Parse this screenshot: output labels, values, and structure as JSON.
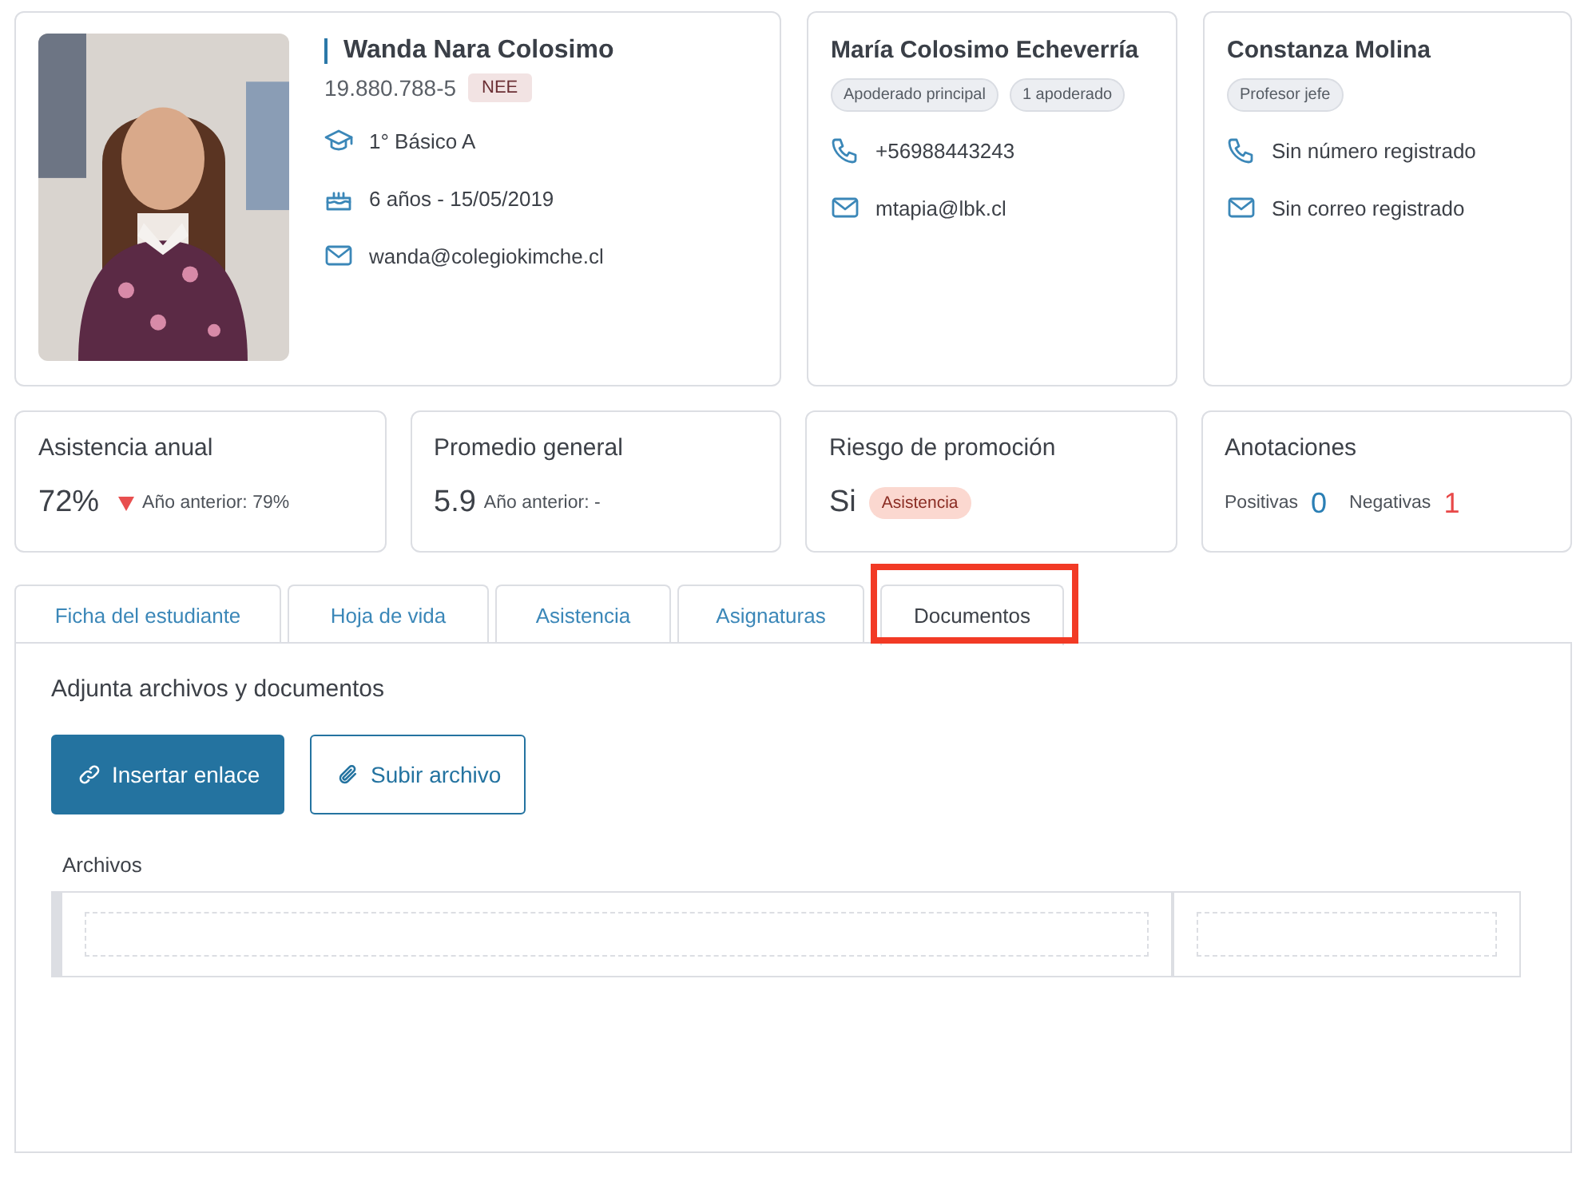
{
  "student": {
    "name": "Wanda Nara Colosimo",
    "rut": "19.880.788-5",
    "badge": "NEE",
    "details": [
      {
        "kind": "course",
        "text": "1° Básico A"
      },
      {
        "kind": "birthday",
        "text": "6 años - 15/05/2019"
      },
      {
        "kind": "email",
        "text": "wanda@colegiokimche.cl"
      }
    ]
  },
  "contacts": [
    {
      "name": "María Colosimo Echeverría",
      "tags": [
        "Apoderado principal",
        "1 apoderado"
      ],
      "details": [
        {
          "kind": "phone",
          "text": "+56988443243"
        },
        {
          "kind": "email",
          "text": "mtapia@lbk.cl"
        }
      ]
    },
    {
      "name": "Constanza Molina",
      "tags": [
        "Profesor jefe"
      ],
      "details": [
        {
          "kind": "phone",
          "text": "Sin número registrado"
        },
        {
          "kind": "email",
          "text": "Sin correo registrado"
        }
      ]
    }
  ],
  "stats": [
    {
      "kind": "trend",
      "title": "Asistencia anual",
      "value": "72%",
      "trend_down": true,
      "note": "Año anterior: 79%"
    },
    {
      "kind": "trend",
      "title": "Promedio general",
      "value": "5.9",
      "note": "Año anterior: -"
    },
    {
      "kind": "risk",
      "title": "Riesgo de promoción",
      "value": "Si",
      "tag": "Asistencia"
    },
    {
      "kind": "notes",
      "title": "Anotaciones",
      "positive_label": "Positivas",
      "positive": "0",
      "negative_label": "Negativas",
      "negative": "1"
    }
  ],
  "tabs": [
    {
      "label": "Ficha del estudiante",
      "selected": false,
      "highlighted": false
    },
    {
      "label": "Hoja de vida",
      "selected": false,
      "highlighted": false
    },
    {
      "label": "Asistencia",
      "selected": false,
      "highlighted": false
    },
    {
      "label": "Asignaturas",
      "selected": false,
      "highlighted": false
    },
    {
      "label": "Documentos",
      "selected": true,
      "highlighted": true
    }
  ],
  "documents": {
    "heading": "Adjunta archivos y documentos",
    "buttons": [
      {
        "kind": "link",
        "label": "Insertar enlace"
      },
      {
        "kind": "upload",
        "label": "Subir archivo"
      }
    ],
    "files_label": "Archivos"
  }
}
